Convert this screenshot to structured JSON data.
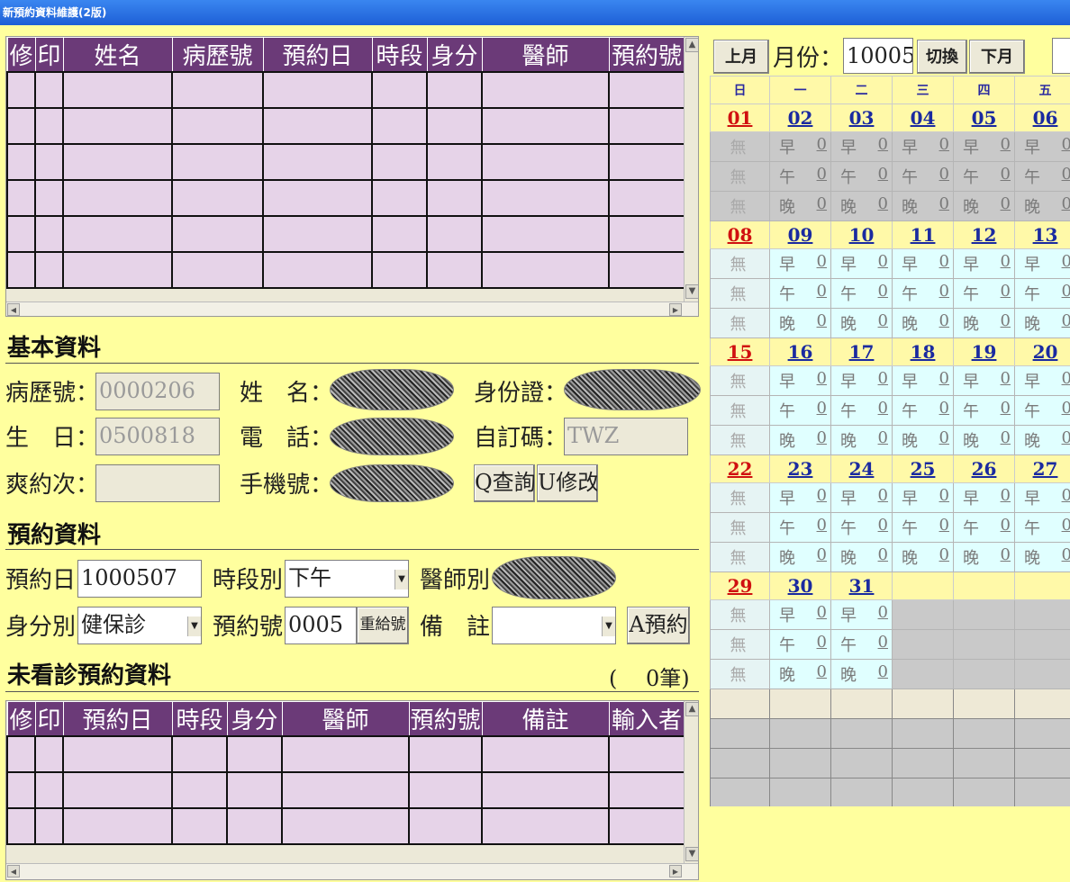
{
  "window": {
    "title": "新預約資料維護(2版)"
  },
  "top_grid": {
    "headers": [
      "修",
      "印",
      "姓名",
      "病歷號",
      "預約日",
      "時段",
      "身分",
      "醫師",
      "預約號"
    ],
    "rows": 6
  },
  "basic": {
    "section": "基本資料",
    "chart_no_label": "病歷號：",
    "chart_no": "0000206",
    "name_label": "姓　名：",
    "id_label": "身份證：",
    "birth_label": "生　日：",
    "birth": "0500818",
    "phone_label": "電　話：",
    "custom_label": "自訂碼：",
    "custom": "TWZ",
    "missed_label": "爽約次：",
    "missed": "",
    "mobile_label": "手機號：",
    "query_btn": "Q查詢",
    "modify_btn": "U修改"
  },
  "appt": {
    "section": "預約資料",
    "date_label": "預約日",
    "date": "1000507",
    "period_label": "時段別",
    "period": "下午",
    "doctor_label": "醫師別",
    "identity_label": "身分別",
    "identity": "健保診",
    "no_label": "預約號",
    "no": "0005",
    "regen_btn": "重給號",
    "note_label": "備　註",
    "note": "",
    "book_btn": "A預約"
  },
  "pending": {
    "section": "未看診預約資料",
    "count": "(　 0筆)",
    "headers": [
      "修",
      "印",
      "預約日",
      "時段",
      "身分",
      "醫師",
      "預約號",
      "備註",
      "輸入者"
    ],
    "rows": 3
  },
  "calendar": {
    "prev": "上月",
    "month_label": "月份：",
    "month": "10005",
    "switch": "切換",
    "next": "下月",
    "weekdays": [
      "日",
      "一",
      "二",
      "三",
      "四",
      "五"
    ],
    "slot_labels": [
      "早",
      "午",
      "晚"
    ],
    "none_label": "無",
    "zero": "0",
    "weeks": [
      {
        "days": [
          "01",
          "02",
          "03",
          "04",
          "05",
          "06"
        ],
        "gray": true
      },
      {
        "days": [
          "08",
          "09",
          "10",
          "11",
          "12",
          "13"
        ],
        "gray": false
      },
      {
        "days": [
          "15",
          "16",
          "17",
          "18",
          "19",
          "20"
        ],
        "gray": false
      },
      {
        "days": [
          "22",
          "23",
          "24",
          "25",
          "26",
          "27"
        ],
        "gray": false
      },
      {
        "days": [
          "29",
          "30",
          "31",
          "",
          "",
          ""
        ],
        "gray": false
      }
    ]
  },
  "icons": {
    "scroll_up": "▲",
    "scroll_down": "▼",
    "scroll_left": "◀",
    "scroll_right": "▶",
    "dropdown": "▼"
  }
}
